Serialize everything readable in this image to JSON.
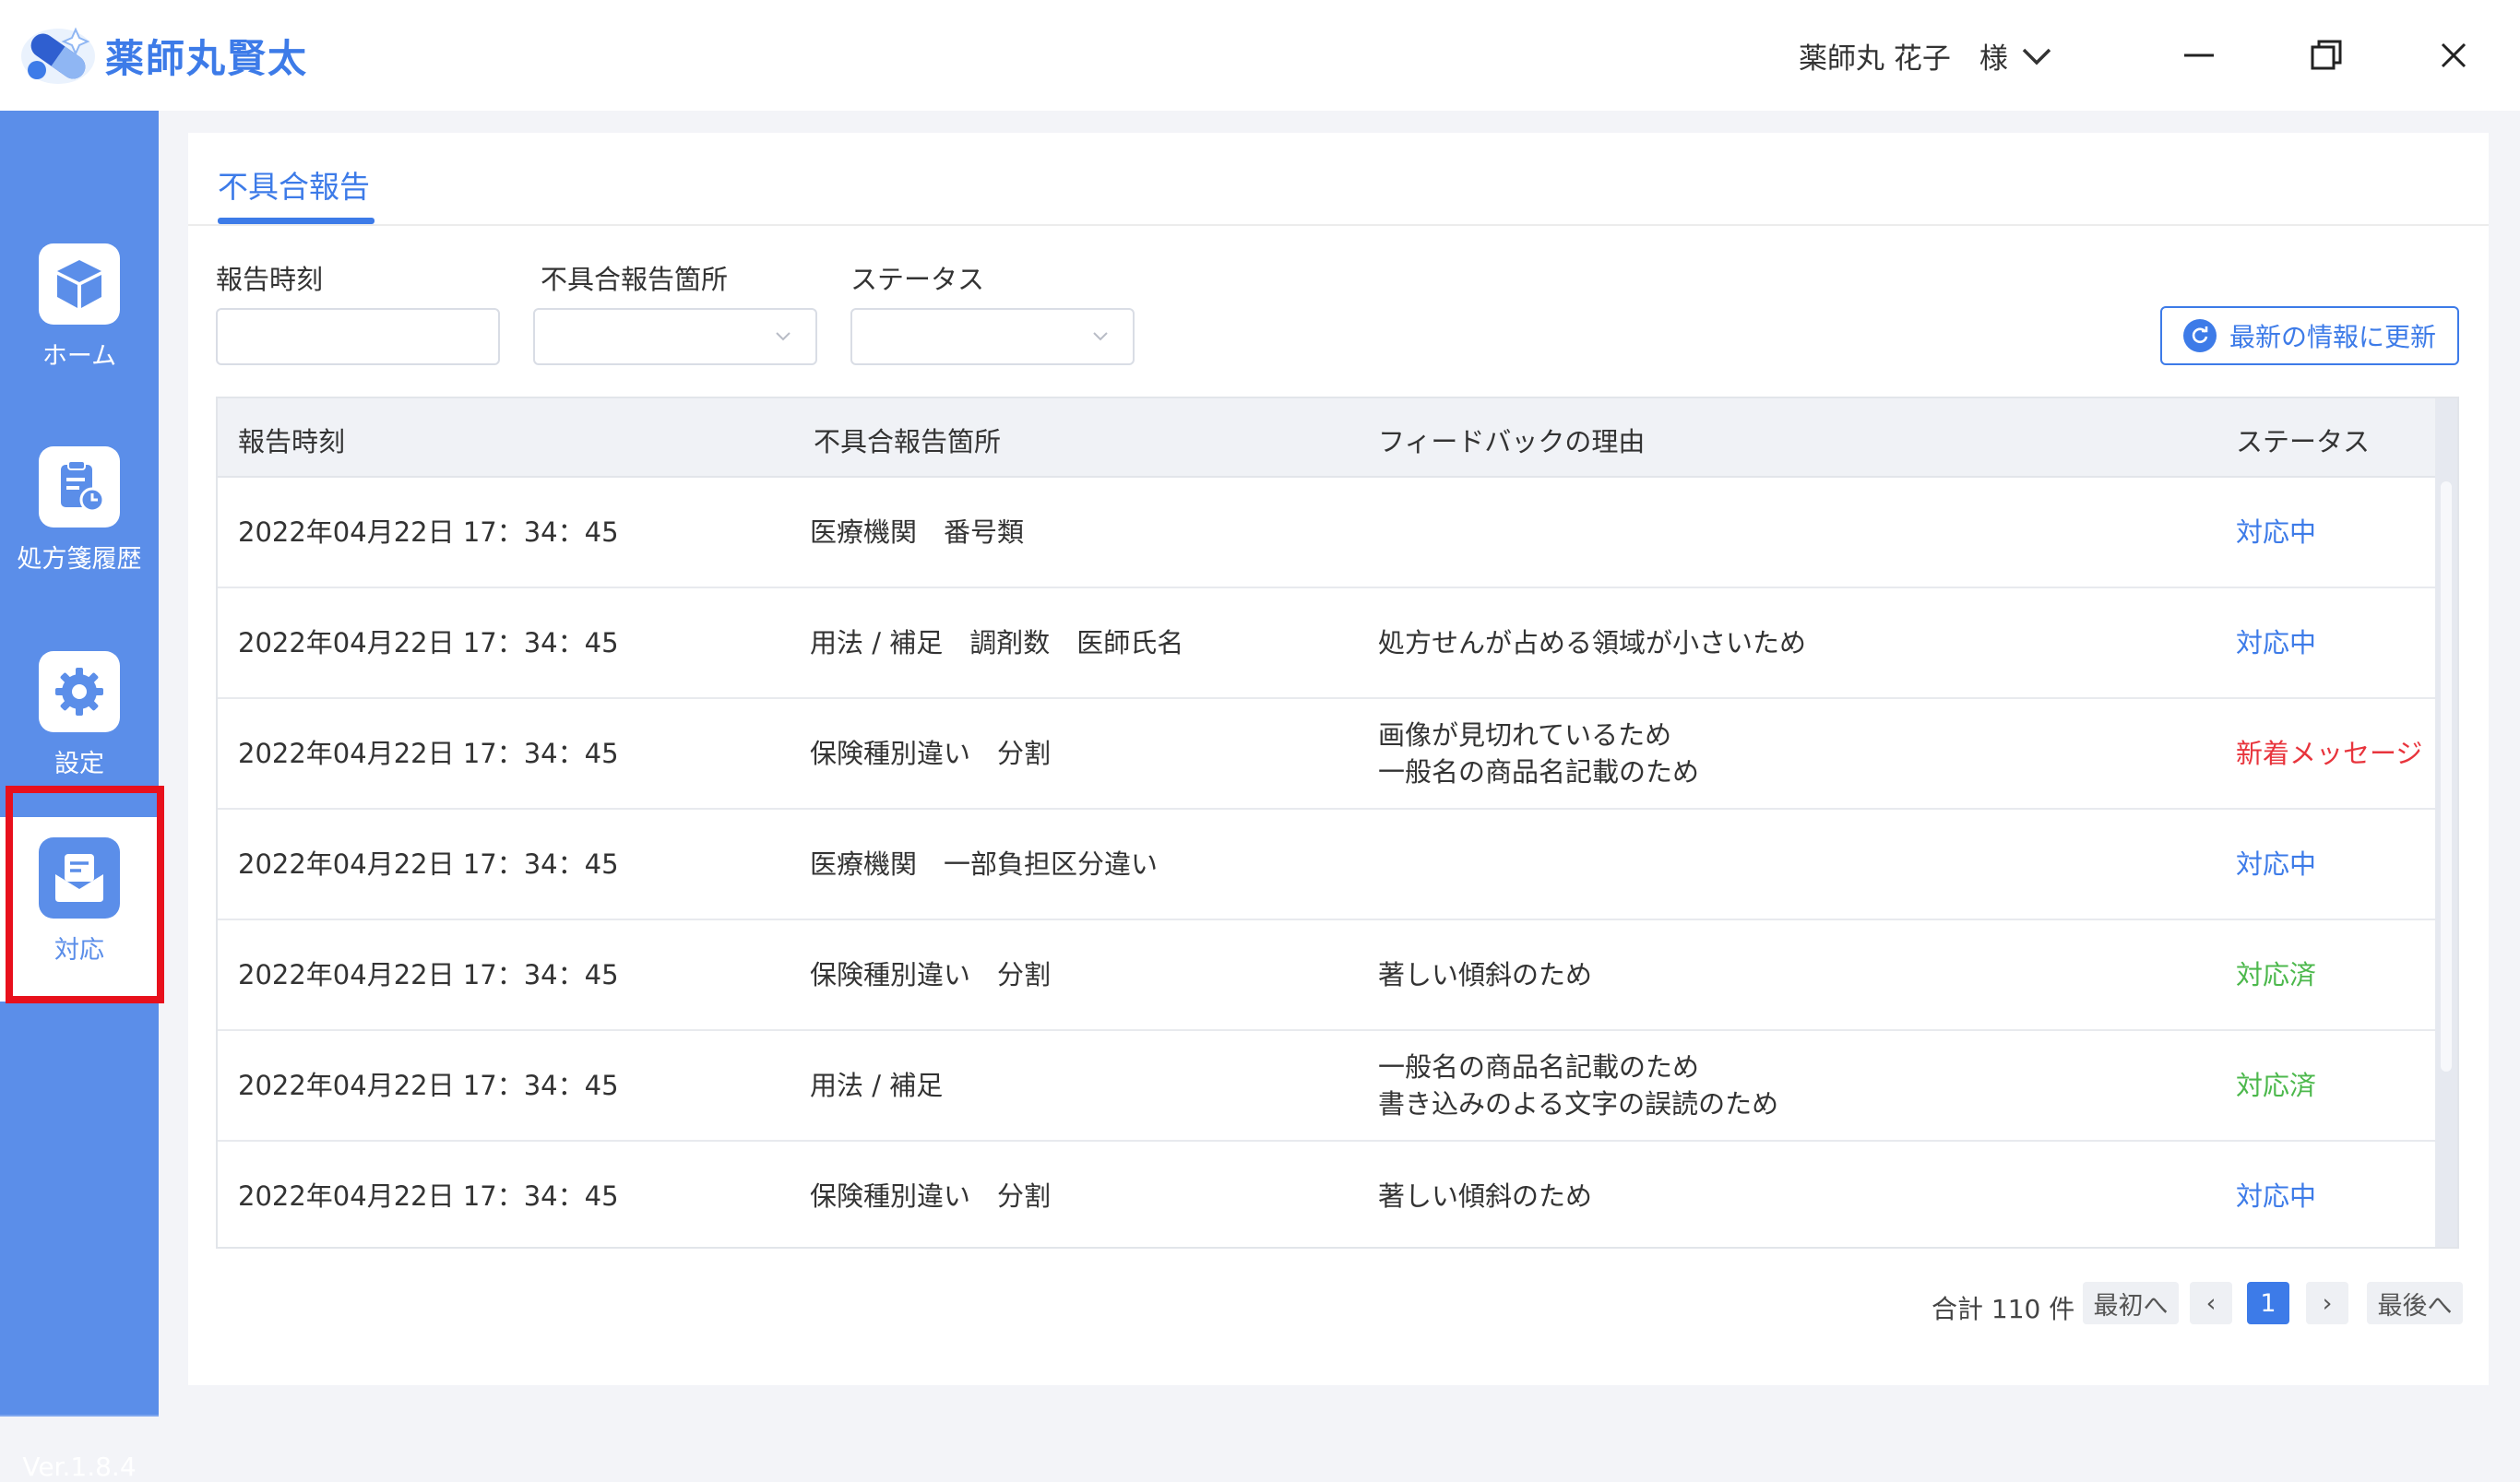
{
  "app": {
    "title": "薬師丸賢太",
    "user_label": "薬師丸 花子　様",
    "version": "Ver.1.8.4"
  },
  "colors": {
    "accent": "#3d7be8",
    "sidebar": "#5b8ee9",
    "status_in_progress": "#3d7be8",
    "status_new_message": "#e8343c",
    "status_done": "#4cb84c",
    "highlight": "#e8101c"
  },
  "sidebar": {
    "items": [
      {
        "label": "ホーム",
        "icon": "cube-icon",
        "active": false
      },
      {
        "label": "処方箋履歴",
        "icon": "prescription-history-icon",
        "active": false
      },
      {
        "label": "設定",
        "icon": "gear-icon",
        "active": false
      },
      {
        "label": "対応",
        "icon": "mail-icon",
        "active": true
      }
    ]
  },
  "main": {
    "tab_label": "不具合報告",
    "filters": {
      "report_time_label": "報告時刻",
      "location_label": "不具合報告箇所",
      "status_label": "ステータス"
    },
    "refresh_button": "最新の情報に更新",
    "table": {
      "headers": [
        "報告時刻",
        "不具合報告箇所",
        "フィードバックの理由",
        "ステータス"
      ],
      "rows": [
        {
          "time": "2022年04月22日 17：34：45",
          "location": "医療機関　番号類",
          "reason1": "",
          "reason2": "",
          "status": "対応中",
          "status_type": "in_progress"
        },
        {
          "time": "2022年04月22日 17：34：45",
          "location": "用法 / 補足　調剤数　医師氏名",
          "reason1": "処方せんが占める領域が小さいため",
          "reason2": "",
          "status": "対応中",
          "status_type": "in_progress"
        },
        {
          "time": "2022年04月22日 17：34：45",
          "location": "保険種別違い　分割",
          "reason1": "画像が見切れているため",
          "reason2": "一般名の商品名記載のため",
          "status": "新着メッセージ",
          "status_type": "new_message"
        },
        {
          "time": "2022年04月22日 17：34：45",
          "location": "医療機関　一部負担区分違い",
          "reason1": "",
          "reason2": "",
          "status": "対応中",
          "status_type": "in_progress"
        },
        {
          "time": "2022年04月22日 17：34：45",
          "location": "保険種別違い　分割",
          "reason1": "著しい傾斜のため",
          "reason2": "",
          "status": "対応済",
          "status_type": "done"
        },
        {
          "time": "2022年04月22日 17：34：45",
          "location": "用法 / 補足",
          "reason1": "一般名の商品名記載のため",
          "reason2": "書き込みのよる文字の誤読のため",
          "status": "対応済",
          "status_type": "done"
        },
        {
          "time": "2022年04月22日 17：34：45",
          "location": "保険種別違い　分割",
          "reason1": "著しい傾斜のため",
          "reason2": "",
          "status": "対応中",
          "status_type": "in_progress"
        }
      ]
    },
    "pagination": {
      "total_text": "合計 110 件",
      "first_label": "最初へ",
      "prev_symbol": "‹",
      "current_page": "1",
      "next_symbol": "›",
      "last_label": "最後へ"
    }
  }
}
